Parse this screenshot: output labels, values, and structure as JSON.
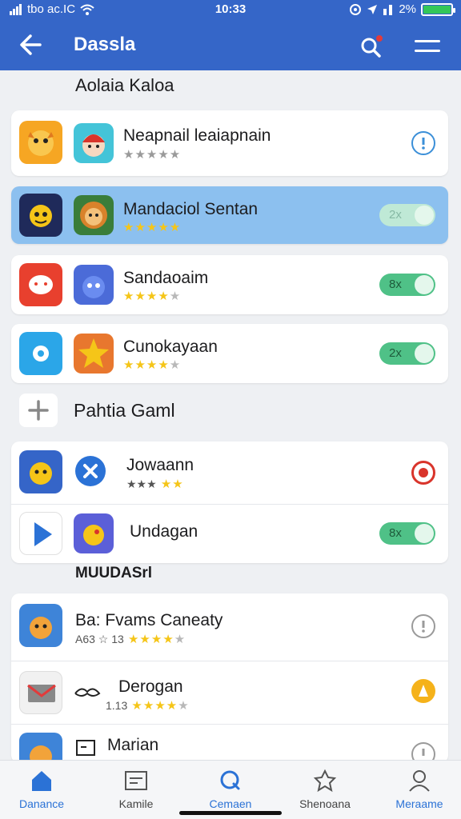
{
  "status_bar": {
    "carrier": "tbo ac.IC",
    "time": "10:33",
    "battery": "2%"
  },
  "app_bar": {
    "title": "Dassla",
    "back_icon": "back-arrow-icon",
    "search_icon": "search-icon",
    "menu_icon": "menu-icon"
  },
  "sections": [
    {
      "title": "Aolaia Kaloa",
      "apps": [
        {
          "name": "Neapnail leaiapnain",
          "rating_prefix": "",
          "stars": "★★★★★",
          "stars_off": "",
          "action": "info",
          "rating_color": "#9a9a9a"
        },
        {
          "name": "Mandaciol Sentan",
          "rating_prefix": "",
          "stars": "★★★★★",
          "stars_off": "",
          "action_label": "2x",
          "action": "pill-faded"
        },
        {
          "name": "Sandaoaim",
          "rating_prefix": "",
          "stars": "★★★★",
          "stars_off": "★",
          "action_label": "8x",
          "action": "pill"
        },
        {
          "name": "Cunokayaan",
          "rating_prefix": "",
          "stars": "★★★★",
          "stars_off": "★",
          "action_label": "2x",
          "action": "pill"
        }
      ]
    },
    {
      "title": "Pahtia Gaml",
      "apps": [
        {
          "name": "Jowaann",
          "rating_prefix": "★★★",
          "stars": "★★",
          "stars_off": "",
          "action": "record"
        },
        {
          "name": "Undagan",
          "action_label": "8x",
          "action": "pill"
        }
      ]
    },
    {
      "title": "MUUDASrl",
      "apps": [
        {
          "name": "Ba: Fvams Caneaty",
          "rating_prefix": "A63 ☆ 13",
          "stars": "★★★★",
          "stars_off": "★",
          "action": "info-outline"
        },
        {
          "name": "Derogan",
          "rating_prefix": "1.13",
          "stars": "★★★★",
          "stars_off": "★",
          "action": "warning"
        },
        {
          "name": "Marian",
          "action": "info-outline"
        }
      ]
    }
  ],
  "bottom_nav": [
    {
      "label": "Danance",
      "icon": "home-icon",
      "active": true
    },
    {
      "label": "Kamile",
      "icon": "gallery-icon",
      "active": false
    },
    {
      "label": "Cemaen",
      "icon": "search-icon",
      "active": true
    },
    {
      "label": "Shenoana",
      "icon": "badge-icon",
      "active": false
    },
    {
      "label": "Meraame",
      "icon": "profile-icon",
      "active": true
    }
  ],
  "colors": {
    "app_bar": "#3566c8",
    "selected_row": "#8cc0ef",
    "pill_green": "#4fc187",
    "star": "#f5c518",
    "nav_active": "#2b72d6"
  }
}
